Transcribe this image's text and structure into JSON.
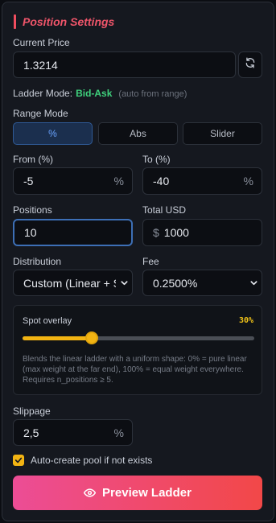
{
  "header": {
    "title": "Position Settings"
  },
  "current_price": {
    "label": "Current Price",
    "value": "1.3214"
  },
  "ladder": {
    "label": "Ladder Mode:",
    "mode": "Bid-Ask",
    "hint": "(auto from range)"
  },
  "range_mode": {
    "label": "Range Mode",
    "options": [
      "%",
      "Abs",
      "Slider"
    ],
    "selected": "%"
  },
  "from": {
    "label": "From (%)",
    "value": "-5",
    "suffix": "%"
  },
  "to": {
    "label": "To (%)",
    "value": "-40",
    "suffix": "%"
  },
  "positions": {
    "label": "Positions",
    "value": "10"
  },
  "total_usd": {
    "label": "Total USD",
    "prefix": "$",
    "value": "1000"
  },
  "distribution": {
    "label": "Distribution",
    "value": "Custom (Linear + Spot"
  },
  "fee": {
    "label": "Fee",
    "value": "0.2500%"
  },
  "spot_overlay": {
    "title": "Spot overlay",
    "percent_label": "30%",
    "percent": 30,
    "description": "Blends the linear ladder with a uniform shape: 0% = pure linear (max weight at the far end), 100% = equal weight everywhere. Requires n_positions ≥ 5."
  },
  "slippage": {
    "label": "Slippage",
    "value": "2,5",
    "suffix": "%"
  },
  "auto_create": {
    "label": "Auto-create pool if not exists",
    "checked": true
  },
  "cta": {
    "label": "Preview Ladder"
  },
  "colors": {
    "accent_red": "#f0556a",
    "accent_gold": "#f2b413",
    "active_blue": "#3d6fb6",
    "mode_green": "#3fd07c"
  }
}
